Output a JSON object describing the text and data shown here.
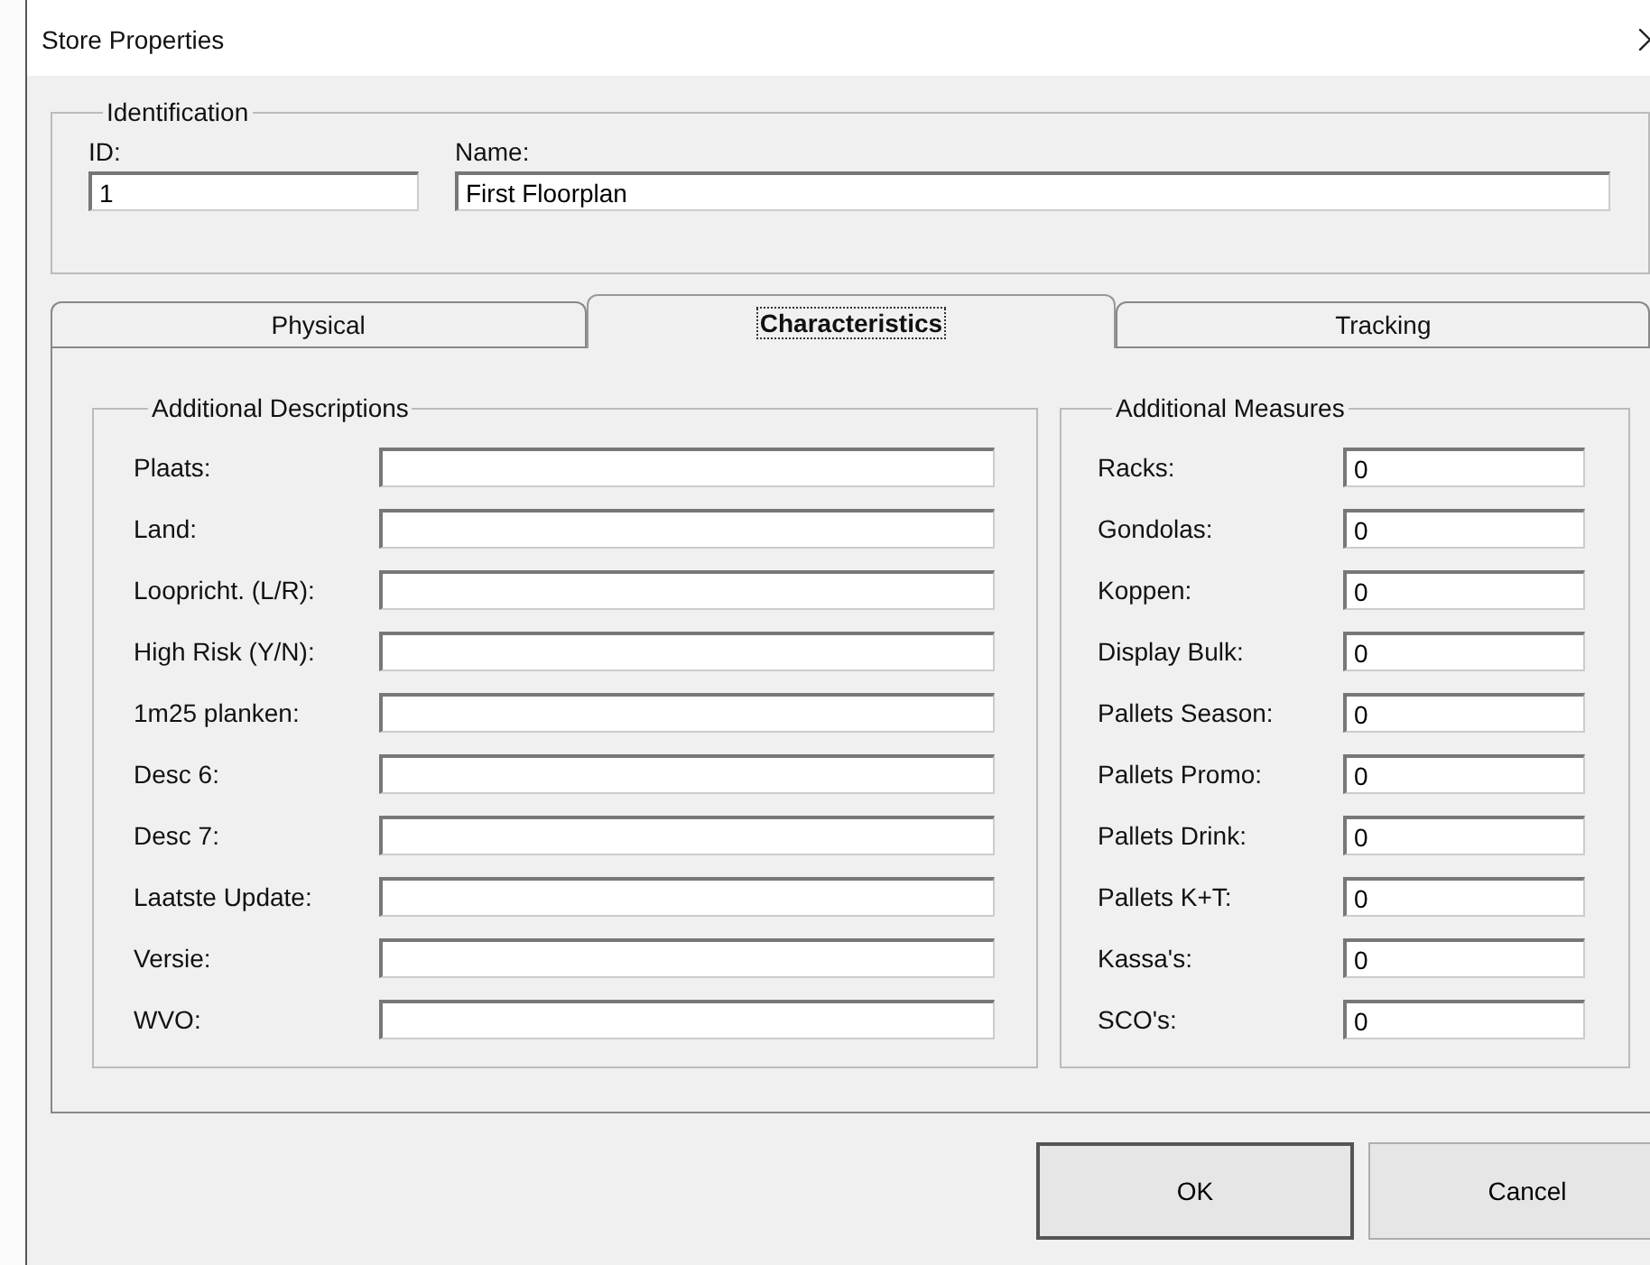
{
  "window": {
    "title": "Store Properties"
  },
  "identification": {
    "title": "Identification",
    "fields": [
      {
        "label": "ID:",
        "value": "1"
      },
      {
        "label": "Name:",
        "value": "First Floorplan"
      }
    ]
  },
  "tabs": [
    {
      "label": "Physical",
      "selected": false
    },
    {
      "label": "Characteristics",
      "selected": true
    },
    {
      "label": "Tracking",
      "selected": false
    }
  ],
  "descriptions": {
    "title": "Additional Descriptions",
    "fields": [
      {
        "label": "Plaats:"
      },
      {
        "label": "Land:"
      },
      {
        "label": "Loopricht. (L/R):"
      },
      {
        "label": "High Risk (Y/N):"
      },
      {
        "label": "1m25 planken:"
      },
      {
        "label": "Desc 6:"
      },
      {
        "label": "Desc 7:"
      },
      {
        "label": "Laatste Update:"
      },
      {
        "label": "Versie:"
      },
      {
        "label": "WVO:"
      }
    ]
  },
  "measures": {
    "title": "Additional Measures",
    "fields": [
      {
        "label": "Racks:",
        "value": "0"
      },
      {
        "label": "Gondolas:",
        "value": "0"
      },
      {
        "label": "Koppen:",
        "value": "0"
      },
      {
        "label": "Display Bulk:",
        "value": "0"
      },
      {
        "label": "Pallets Season:",
        "value": "0"
      },
      {
        "label": "Pallets Promo:",
        "value": "0"
      },
      {
        "label": "Pallets Drink:",
        "value": "0"
      },
      {
        "label": "Pallets K+T:",
        "value": "0"
      },
      {
        "label": "Kassa's:",
        "value": "0"
      },
      {
        "label": "SCO's:",
        "value": "0"
      }
    ]
  },
  "buttons": [
    "OK",
    "Cancel"
  ]
}
